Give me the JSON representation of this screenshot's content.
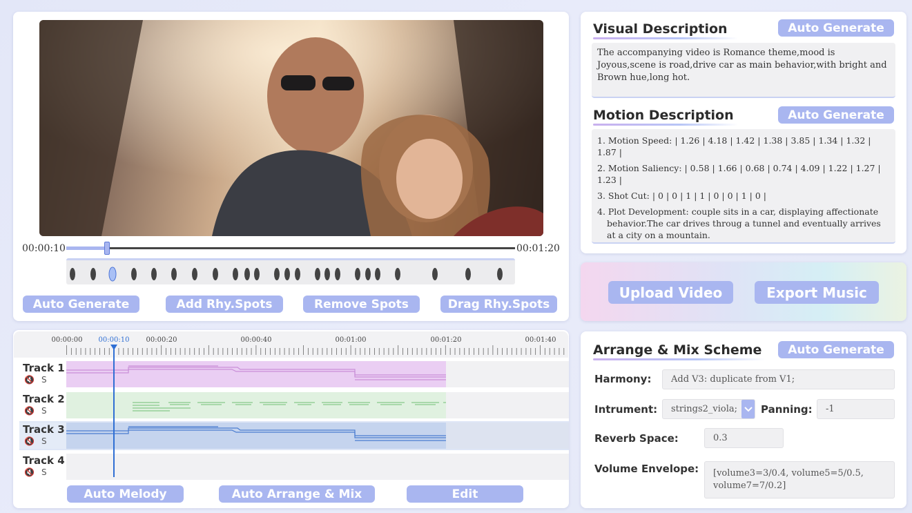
{
  "video": {
    "current_time": "00:00:10",
    "total_time": "00:01:20",
    "progress_fraction": 0.09,
    "buttons": {
      "auto_generate": "Auto Generate",
      "add_spots": "Add Rhy.Spots",
      "remove_spots": "Remove Spots",
      "drag_spots": "Drag Rhy.Spots"
    }
  },
  "visual_description": {
    "title": "Visual Description",
    "button": "Auto Generate",
    "text": "The accompanying video is Romance theme,mood is Joyous,scene is road,drive car as main behavior,with bright and Brown hue,long hot."
  },
  "motion_description": {
    "title": "Motion Description",
    "button": "Auto Generate",
    "lines": [
      "1. Motion Speed: | 1.26 | 4.18 | 1.42 | 1.38 | 3.85 | 1.34 | 1.32 | 1.87 |",
      "2. Motion Saliency: | 0.58 | 1.66 | 0.68 | 0.74 | 4.09 | 1.22 | 1.27 | 1.23 |",
      "3. Shot Cut: | 0 | 0 | 1 | 1 | 0 | 0 | 1 | 0 |",
      "4. Plot Development: couple sits in a car, displaying affectionate behavior.The car drives throug a tunnel and eventually arrives at a city on a mountain."
    ]
  },
  "actions": {
    "upload_video": "Upload Video",
    "export_music": "Export Music"
  },
  "timeline": {
    "ruler_labels": [
      "00:00:00",
      "00:00:10",
      "00:00:20",
      "00:00:40",
      "00:01:00",
      "00:01:20",
      "00:01:40"
    ],
    "tracks": [
      {
        "name": "Track 1",
        "solo": "S"
      },
      {
        "name": "Track 2",
        "solo": "S"
      },
      {
        "name": "Track 3",
        "solo": "S"
      },
      {
        "name": "Track 4",
        "solo": "S"
      }
    ],
    "buttons": {
      "auto_melody": "Auto Melody",
      "auto_arrange": "Auto Arrange & Mix",
      "edit": "Edit"
    }
  },
  "arrange": {
    "title": "Arrange & Mix Scheme",
    "button": "Auto Generate",
    "harmony_label": "Harmony:",
    "harmony_value": "Add V3: duplicate from V1;",
    "instrument_label": "Intrument:",
    "instrument_value": "strings2_viola;",
    "panning_label": "Panning:",
    "panning_value": "-1",
    "reverb_label": "Reverb Space:",
    "reverb_value": "0.3",
    "volume_label": "Volume Envelope:",
    "volume_value": "[volume3=3/0.4, volume5=5/0.5, volume7=7/0.2]"
  },
  "colors": {
    "accent": "#a9b6f0",
    "track1": "#e9c8f2",
    "track2": "#e0f1e0",
    "track3": "#c5d4ee",
    "playhead": "#2f6fd4"
  }
}
